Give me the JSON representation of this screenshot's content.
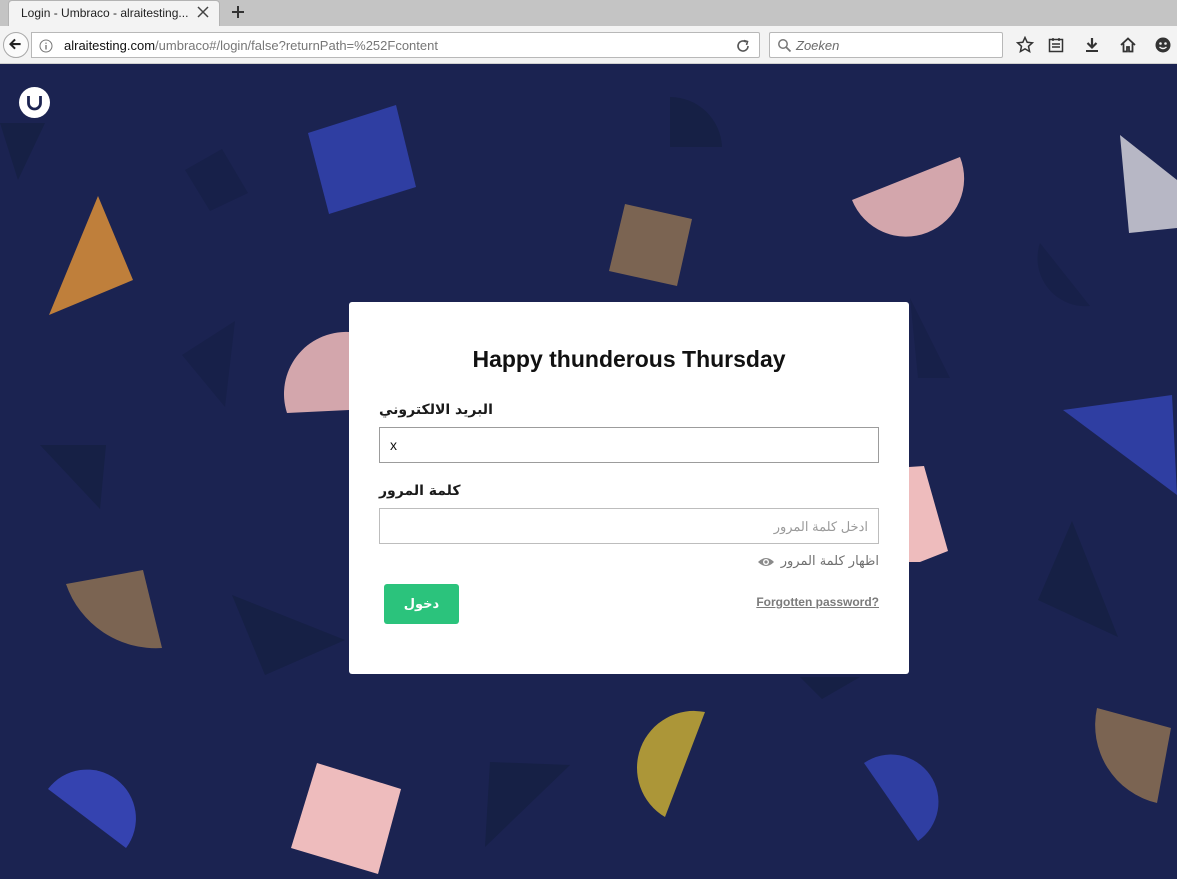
{
  "browser": {
    "tab_title": "Login - Umbraco - alraitesting...",
    "url_host": "alraitesting.com",
    "url_path": "/umbraco#/login/false?returnPath=%252Fcontent",
    "search_placeholder": "Zoeken"
  },
  "login": {
    "greeting": "Happy thunderous Thursday",
    "email_label": "البريد الالكتروني",
    "email_value": "x",
    "password_label": "كلمة المرور",
    "password_placeholder": "ادخل كلمة المرور",
    "show_password_label": "اظهار كلمة المرور",
    "login_button": "دخول",
    "forgot_password": "Forgotten password?"
  },
  "colors": {
    "background": "#1b2351",
    "button": "#2bc37c"
  }
}
